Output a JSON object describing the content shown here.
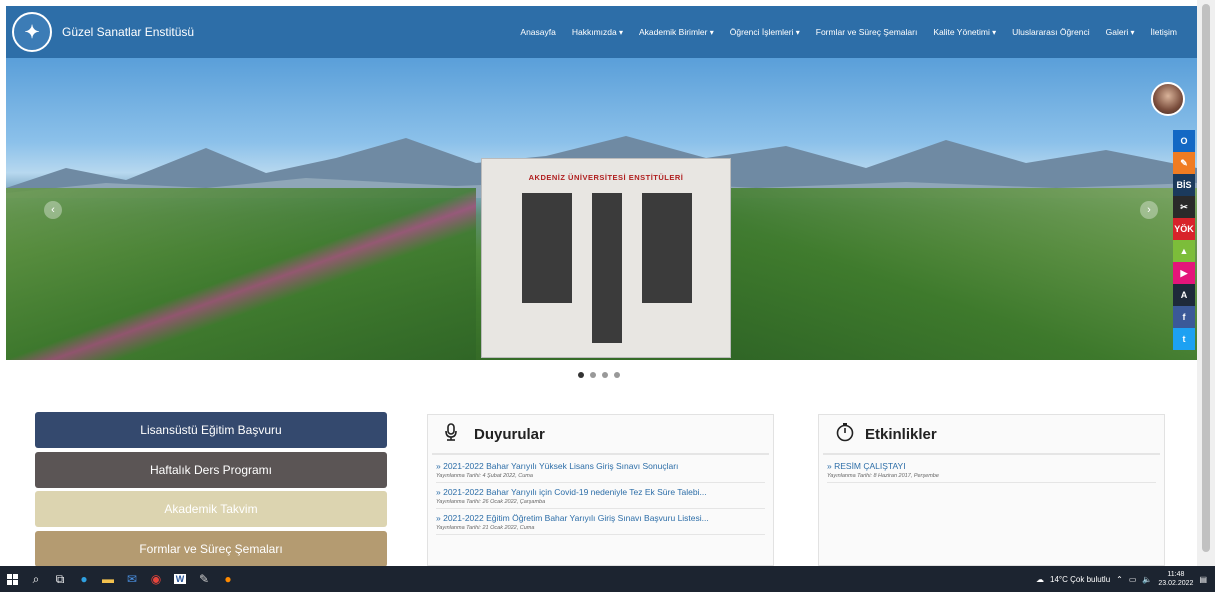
{
  "brand": {
    "name": "Güzel Sanatlar Enstitüsü"
  },
  "nav": {
    "items": [
      {
        "label": "Anasayfa",
        "caret": false
      },
      {
        "label": "Hakkımızda",
        "caret": true
      },
      {
        "label": "Akademik Birimler",
        "caret": true
      },
      {
        "label": "Öğrenci İşlemleri",
        "caret": true
      },
      {
        "label": "Formlar ve Süreç Şemaları",
        "caret": false
      },
      {
        "label": "Kalite Yönetimi",
        "caret": true
      },
      {
        "label": "Uluslararası Öğrenci",
        "caret": false
      },
      {
        "label": "Galeri",
        "caret": true
      },
      {
        "label": "İletişim",
        "caret": false
      }
    ]
  },
  "hero": {
    "building_sign": "AKDENİZ ÜNİVERSİTESİ ENSTİTÜLERİ",
    "prev_icon": "‹",
    "next_icon": "›"
  },
  "social": [
    {
      "name": "outlook-icon",
      "color": "#1368c4",
      "glyph": "O"
    },
    {
      "name": "pencil-icon",
      "color": "#f07c22",
      "glyph": "✎"
    },
    {
      "name": "bis-icon",
      "color": "#1b3a5c",
      "glyph": "BİS"
    },
    {
      "name": "tools-icon",
      "color": "#2a2a2a",
      "glyph": "✂"
    },
    {
      "name": "yok-bis-icon",
      "color": "#d8232a",
      "glyph": "YÖK"
    },
    {
      "name": "android-icon",
      "color": "#7cbd3a",
      "glyph": "▲"
    },
    {
      "name": "video-icon",
      "color": "#e4157a",
      "glyph": "▶"
    },
    {
      "name": "akdeniz-icon",
      "color": "#1e2a3a",
      "glyph": "A"
    },
    {
      "name": "facebook-icon",
      "color": "#3b5998",
      "glyph": "f"
    },
    {
      "name": "twitter-icon",
      "color": "#1da1f2",
      "glyph": "t"
    }
  ],
  "quick_buttons": [
    {
      "label": "Lisansüstü Eğitim Başvuru",
      "color": "#34496e"
    },
    {
      "label": "Haftalık Ders Programı",
      "color": "#5b5555"
    },
    {
      "label": "Akademik Takvim",
      "color": "#dcd4b0"
    },
    {
      "label": "Formlar ve Süreç Şemaları",
      "color": "#b49b71"
    }
  ],
  "announcements": {
    "title": "Duyurular",
    "items": [
      {
        "title": "» 2021-2022 Bahar Yarıyılı Yüksek Lisans Giriş Sınavı Sonuçları",
        "date": "Yayınlanma Tarihi: 4 Şubat 2022, Cuma"
      },
      {
        "title": "» 2021-2022 Bahar Yarıyılı için Covid-19 nedeniyle Tez Ek Süre Talebi...",
        "date": "Yayınlanma Tarihi: 26 Ocak 2022, Çarşamba"
      },
      {
        "title": "» 2021-2022 Eğitim Öğretim Bahar Yarıyılı Giriş Sınavı Başvuru Listesi...",
        "date": "Yayınlanma Tarihi: 21 Ocak 2022, Cuma"
      }
    ]
  },
  "events": {
    "title": "Etkinlikler",
    "items": [
      {
        "title": "» RESİM ÇALIŞTAYI",
        "date": "Yayınlanma Tarihi: 8 Haziran 2017, Perşembe"
      }
    ]
  },
  "taskbar": {
    "weather": "14°C  Çok bulutlu",
    "time": "11:48",
    "date": "23.02.2022"
  }
}
